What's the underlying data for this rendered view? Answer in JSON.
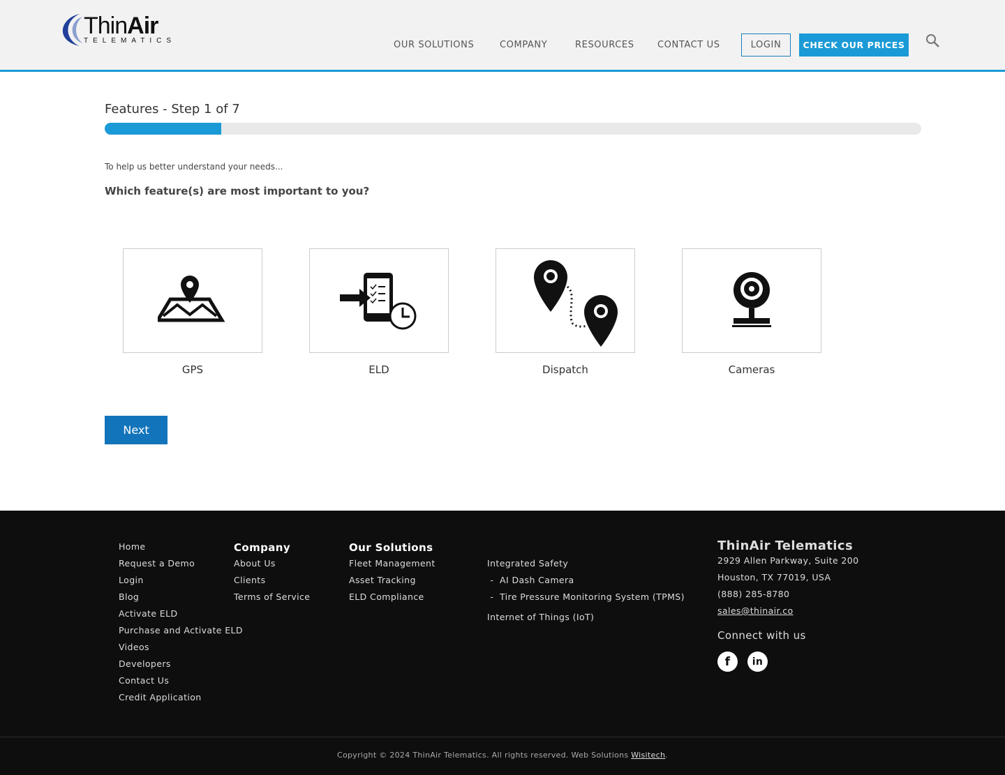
{
  "header": {
    "logo_main": "Thin",
    "logo_bold": "Air",
    "logo_sub": "TELEMATICS",
    "nav": [
      "OUR SOLUTIONS",
      "COMPANY",
      "RESOURCES",
      "CONTACT US"
    ],
    "login": "LOGIN",
    "prices": "CHECK OUR PRICES",
    "search_icon": "search-icon",
    "accent": "#1a9ad6"
  },
  "wizard": {
    "title": "Features - Step 1 of 7",
    "progress_percent": 14.3,
    "intro": "To help us better understand your needs...",
    "question": "Which feature(s) are most important to you?",
    "options": [
      {
        "label": "GPS",
        "icon": "map-pin-icon"
      },
      {
        "label": "ELD",
        "icon": "phone-checklist-clock-icon"
      },
      {
        "label": "Dispatch",
        "icon": "route-pins-icon"
      },
      {
        "label": "Cameras",
        "icon": "webcam-icon"
      }
    ],
    "next": "Next"
  },
  "footer": {
    "links": [
      "Home",
      "Request a Demo",
      "Login",
      "Blog",
      "Activate ELD",
      "Purchase and Activate ELD",
      "Videos",
      "Developers",
      "Contact Us",
      "Credit Application"
    ],
    "company": {
      "heading": "Company",
      "items": [
        "About Us",
        "Clients",
        "Terms of Service"
      ]
    },
    "solutions": {
      "heading": "Our Solutions",
      "items": [
        "Fleet Management",
        "Asset Tracking",
        "ELD Compliance"
      ]
    },
    "solutions2": [
      "Integrated Safety",
      " -  AI Dash Camera",
      " -  Tire Pressure Monitoring System (TPMS)",
      "Internet of Things (IoT)"
    ],
    "contact": {
      "heading": "ThinAir Telematics",
      "address1": "2929 Allen Parkway, Suite 200",
      "address2": "Houston, TX 77019, USA",
      "phone": "(888) 285-8780",
      "email": "sales@thinair.co",
      "connect": "Connect with us",
      "facebook": "f",
      "linkedin": "in"
    },
    "copyright": "Copyright © 2024 ThinAir Telematics. All rights reserved. Web Solutions ",
    "credit": "Wisitech",
    "period": "."
  }
}
